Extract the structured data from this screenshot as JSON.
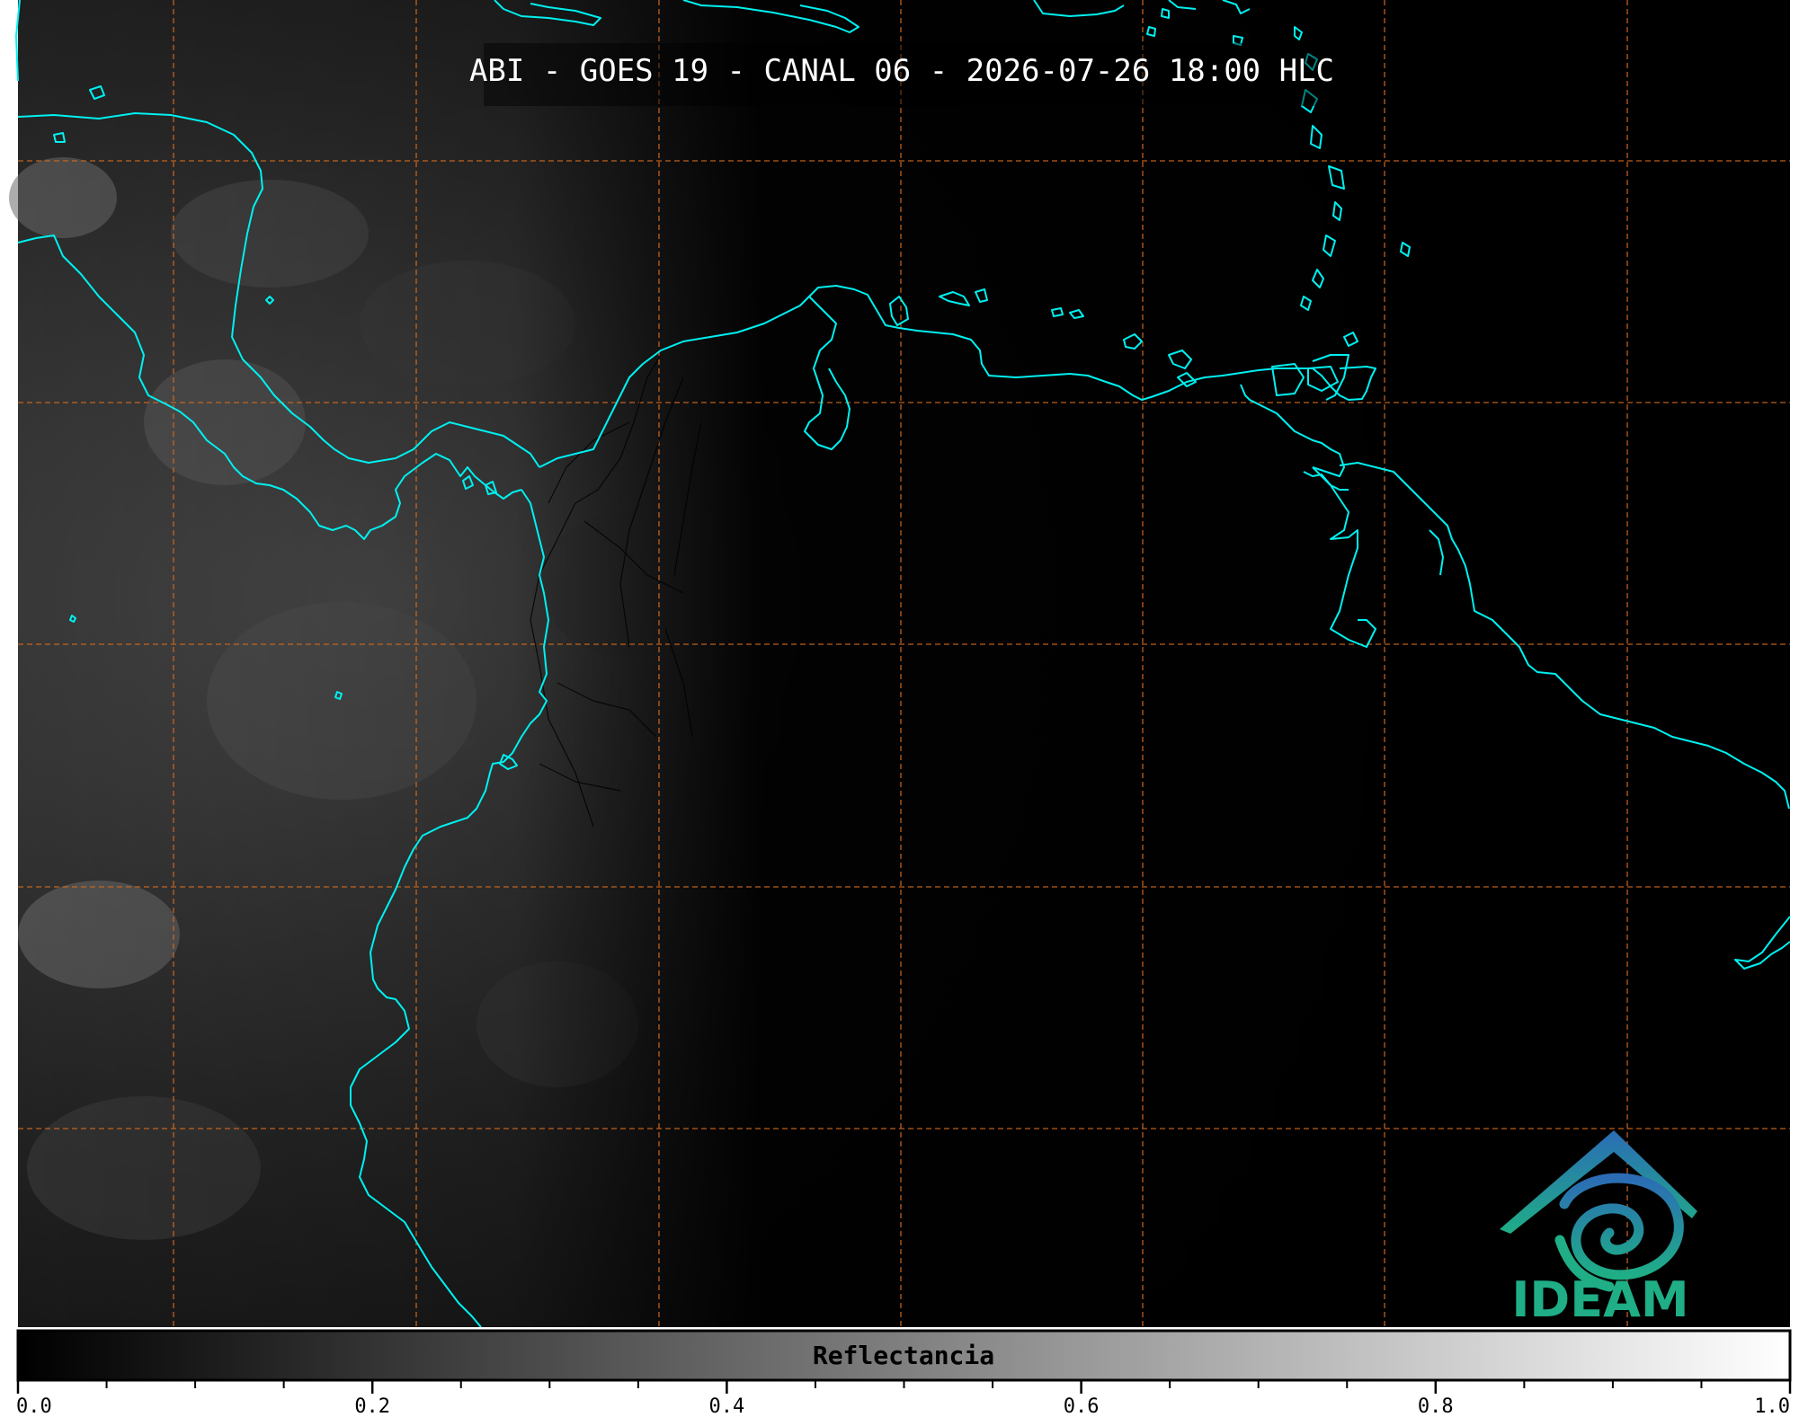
{
  "title": "ABI - GOES 19 - CANAL 06 - 2026-07-26 18:00 HLC",
  "colorbar": {
    "label": "Reflectancia",
    "range": [
      0.0,
      1.0
    ],
    "labeled_ticks": [
      "0.0",
      "0.2",
      "0.4",
      "0.6",
      "0.8",
      "1.0"
    ],
    "minor_ticks_per_interval": 4,
    "gradient": [
      "#000000",
      "#ffffff"
    ]
  },
  "logo": {
    "text": "IDEAM",
    "colors": {
      "blue": "#2b6cb5",
      "teal": "#1fae86"
    }
  },
  "colors": {
    "coastline": "#00f0f0",
    "graticule": "#d2691e",
    "borders": "#000000",
    "background": "#000000"
  },
  "graticule": {
    "style": "dashed",
    "vertical_lines": 7,
    "horizontal_lines": 5
  }
}
